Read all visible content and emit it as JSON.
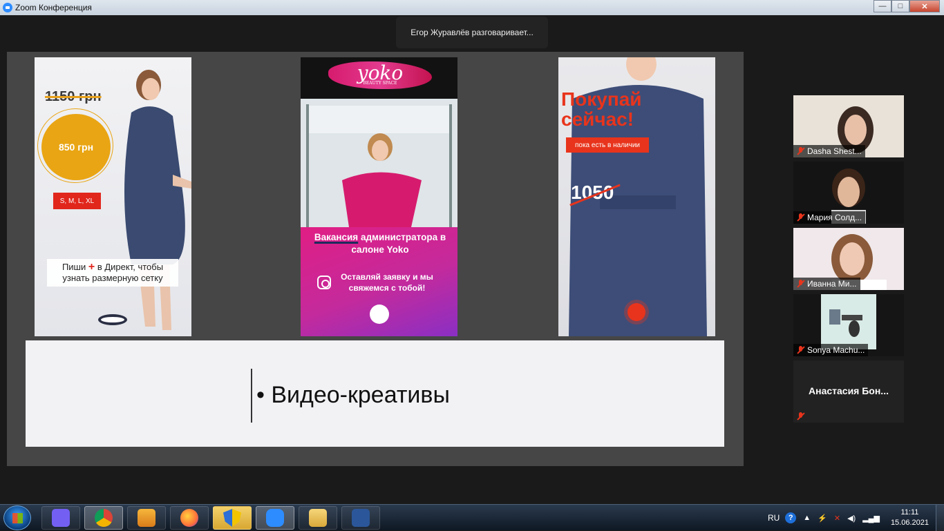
{
  "window": {
    "title": "Zoom Конференция",
    "controls": {
      "minimize": "—",
      "maximize": "□",
      "close": "✕"
    }
  },
  "speaker_banner": "Егор Журавлёв разговаривает...",
  "shared_slide": {
    "creative1": {
      "old_price": "1150 грн",
      "new_price": "850 грн",
      "sizes": "S, M, L, XL",
      "plus_glyph": "+",
      "direct_line1": "в Директ, чтобы",
      "direct_prefix": "Пиши",
      "direct_line2": "узнать размерную сетку"
    },
    "creative2": {
      "logo": "yoko",
      "logo_sub": "BEAUTY SPACE",
      "headline_highlight": "Вакансия",
      "headline_rest": "администратора в салоне Yoko",
      "subline": "Оставляй заявку и мы свяжемся с тобой!"
    },
    "creative3": {
      "title_line1": "Покупай",
      "title_line2": "сейчас!",
      "cta": "пока есть в наличии",
      "price": "1050"
    },
    "bullet_text": "• Видео-креативы"
  },
  "participants": [
    {
      "name": "Dasha Shest...",
      "muted": true
    },
    {
      "name": "Мария Солд...",
      "muted": true
    },
    {
      "name": "Иванна Ми...",
      "muted": true
    },
    {
      "name": "Sonya Machu...",
      "muted": true
    },
    {
      "name": "Анастасия  Бон...",
      "muted": true,
      "video": false
    }
  ],
  "taskbar": {
    "apps": [
      "viber",
      "chrome",
      "video-player",
      "firefox",
      "security-shield",
      "zoom",
      "file-explorer",
      "word"
    ],
    "language": "RU",
    "help": "?",
    "time": "11:11",
    "date": "15.06.2021"
  },
  "colors": {
    "zoom_blue": "#2d8cff",
    "price_yellow": "#e9a513",
    "accent_red": "#e8341c",
    "yoko_pink": "#e01e84",
    "yoko_purple": "#8a2fc4"
  }
}
